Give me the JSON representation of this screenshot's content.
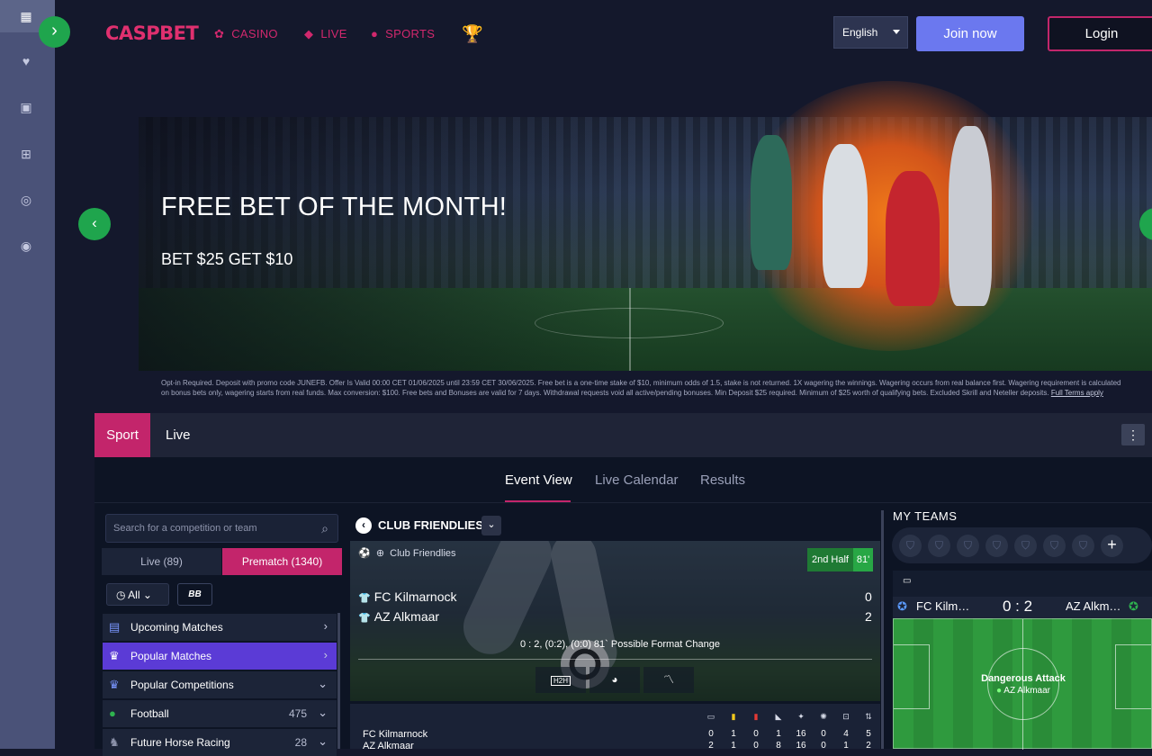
{
  "header": {
    "logo": "CASPBET",
    "nav": [
      {
        "label": "CASINO",
        "icon": "dice-icon"
      },
      {
        "label": "LIVE",
        "icon": "live-cards-icon"
      },
      {
        "label": "SPORTS",
        "icon": "basketball-icon"
      }
    ],
    "language": "English",
    "join_label": "Join now",
    "login_label": "Login"
  },
  "hero": {
    "title": "FREE BET OF THE MONTH!",
    "subtitle": "BET $25 GET $10",
    "terms": "Opt-in Required. Deposit with promo code JUNEFB. Offer Is Valid 00:00 CET 01/06/2025 until 23:59 CET 30/06/2025. Free bet is a one-time stake of $10, minimum odds of 1.5, stake is not returned. 1X wagering the winnings. Wagering occurs from real balance first. Wagering requirement is calculated on bonus bets only, wagering starts from real funds. Max conversion: $100. Free bets and Bonuses are valid for 7 days. Withdrawal requests void all active/pending bonuses. Min Deposit $25 required. Minimum of $25 worth of qualifying bets. Excluded Skrill and Neteller deposits.",
    "terms_link": "Full Terms apply"
  },
  "panel": {
    "tabs": [
      "Sport",
      "Live"
    ],
    "view_tabs": [
      "Event View",
      "Live Calendar",
      "Results"
    ],
    "search_placeholder": "Search for a competition or team",
    "live_toggle": "Live (89)",
    "prematch_toggle": "Prematch (1340)",
    "filter_all": "All",
    "bb_label": "BB",
    "list": [
      {
        "label": "Upcoming Matches",
        "count": ""
      },
      {
        "label": "Popular Matches",
        "count": ""
      },
      {
        "label": "Popular Competitions",
        "count": ""
      },
      {
        "label": "Football",
        "count": "475"
      },
      {
        "label": "Future Horse Racing",
        "count": "28"
      }
    ]
  },
  "event": {
    "competition": "CLUB FRIENDLIES",
    "breadcrumb": "Club Friendlies",
    "period": "2nd Half",
    "minute": "81'",
    "home": "FC Kilmarnock",
    "away": "AZ Alkmaar",
    "home_score": "0",
    "away_score": "2",
    "format_note": "0 : 2, (0:2), (0:0) 81`  Possible Format Change",
    "h2h": "H2H",
    "stats_home": "FC Kilmarnock",
    "stats_away": "AZ Alkmaar",
    "stat_values_home": [
      "0",
      "1",
      "0",
      "1",
      "16",
      "0",
      "4",
      "5"
    ],
    "stat_values_away": [
      "2",
      "1",
      "0",
      "8",
      "16",
      "0",
      "1",
      "2"
    ]
  },
  "my_teams": {
    "title": "MY TEAMS",
    "home_short": "FC Kilm…",
    "away_short": "AZ Alkm…",
    "score": "0 : 2",
    "attack_label": "Dangerous Attack",
    "attack_team": "AZ Alkmaar"
  },
  "colors": {
    "accent": "#c3256b",
    "green": "#1fa54d",
    "join": "#6b78ef"
  }
}
